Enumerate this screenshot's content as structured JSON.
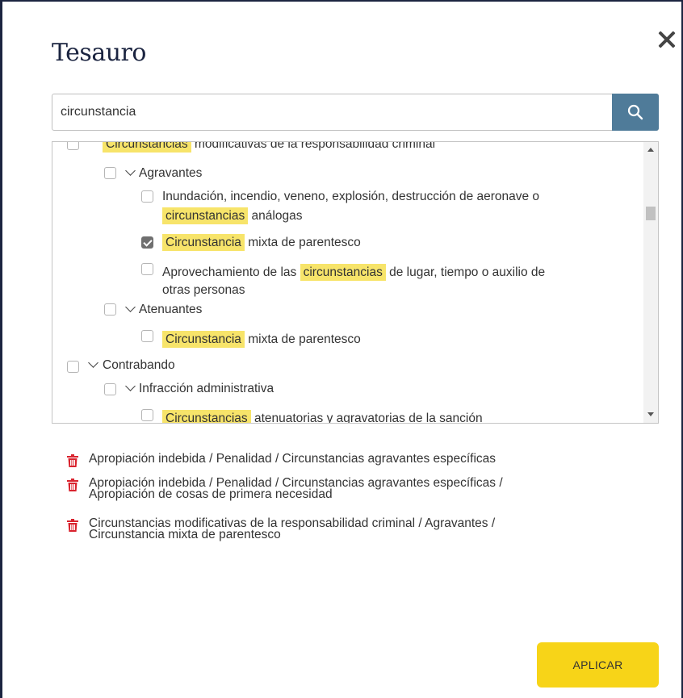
{
  "dialog": {
    "title": "Tesauro",
    "close_icon": "close-icon"
  },
  "search": {
    "value": "circunstancia",
    "button_icon": "search-icon",
    "button_color": "#4f7b99"
  },
  "tree": {
    "highlight_color": "#f7e46a",
    "rows": [
      {
        "checked": false,
        "expanded": false,
        "pre": "",
        "hl": "Circunstancias",
        "post": " modificativas de la responsabilidad criminal",
        "line2_pre": "",
        "line2_hl": "",
        "line2_post": ""
      },
      {
        "checked": false,
        "expanded": true,
        "pre": "Agravantes",
        "hl": "",
        "post": "",
        "line2_pre": "",
        "line2_hl": "",
        "line2_post": ""
      },
      {
        "checked": false,
        "expanded": false,
        "pre": "Inundación, incendio, veneno, explosión, destrucción de aeronave o",
        "hl": "",
        "post": "",
        "line2_pre": "",
        "line2_hl": "circunstancias",
        "line2_post": " análogas"
      },
      {
        "checked": true,
        "expanded": false,
        "pre": "",
        "hl": "Circunstancia",
        "post": " mixta de parentesco",
        "line2_pre": "",
        "line2_hl": "",
        "line2_post": ""
      },
      {
        "checked": false,
        "expanded": false,
        "pre": "Aprovechamiento de las ",
        "hl": "circunstancias",
        "post": " de lugar, tiempo o auxilio de",
        "line2_pre": "otras personas",
        "line2_hl": "",
        "line2_post": ""
      },
      {
        "checked": false,
        "expanded": true,
        "pre": "Atenuantes",
        "hl": "",
        "post": "",
        "line2_pre": "",
        "line2_hl": "",
        "line2_post": ""
      },
      {
        "checked": false,
        "expanded": false,
        "pre": "",
        "hl": "Circunstancia",
        "post": " mixta de parentesco",
        "line2_pre": "",
        "line2_hl": "",
        "line2_post": ""
      },
      {
        "checked": false,
        "expanded": true,
        "pre": "Contrabando",
        "hl": "",
        "post": "",
        "line2_pre": "",
        "line2_hl": "",
        "line2_post": ""
      },
      {
        "checked": false,
        "expanded": true,
        "pre": "Infracción administrativa",
        "hl": "",
        "post": "",
        "line2_pre": "",
        "line2_hl": "",
        "line2_post": ""
      },
      {
        "checked": false,
        "expanded": false,
        "pre": "",
        "hl": "Circunstancias",
        "post": " atenuatorias y agravatorias de la sanción",
        "line2_pre": "",
        "line2_hl": "",
        "line2_post": ""
      }
    ]
  },
  "selections": {
    "icon": "trash-icon",
    "icon_color": "#d9232e",
    "items": [
      {
        "line1": "Apropiación indebida / Penalidad / Circunstancias agravantes específicas",
        "line2": ""
      },
      {
        "line1": "Apropiación indebida / Penalidad / Circunstancias agravantes específicas /",
        "line2": "Apropiación de cosas de primera necesidad"
      },
      {
        "line1": "Circunstancias modificativas de la responsabilidad criminal / Agravantes /",
        "line2": "Circunstancia mixta de parentesco"
      }
    ]
  },
  "apply_button": {
    "label": "APLICAR",
    "color": "#f7d418"
  }
}
